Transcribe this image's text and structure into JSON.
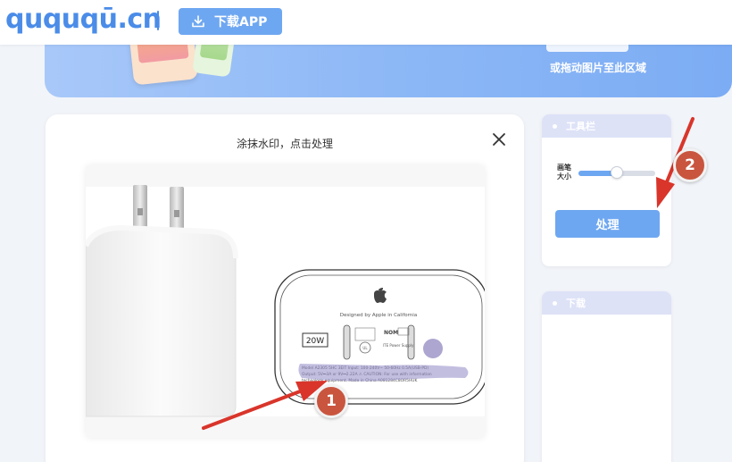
{
  "header": {
    "logo_text": "ququqū.cn",
    "app_button_label": "下载APP"
  },
  "banner": {
    "drop_hint": "或拖动图片至此区域"
  },
  "editor": {
    "title": "涂抹水印，点击处理",
    "image": {
      "label_designed": "Designed by Apple in California",
      "wattage": "20W",
      "nom_text": "NOM",
      "supply_text": "ITE Power Supply",
      "reg_line1": "Model A2305 5HC 3EIT Input: 100-240V~ 50-60Hz 0.5A(USB-PD)",
      "reg_line2": "Output: 5V⎓3A or 9V⎓2.22A ⚠ CAUTION: For use with information",
      "reg_line3": "technology equipment. Made in China A081284C8OR5HUK"
    }
  },
  "toolbox": {
    "header": "工具栏",
    "brush_label": "画笔 大小",
    "brush_size_fraction": 0.5,
    "process_label": "处理"
  },
  "download": {
    "header": "下载"
  },
  "annotations": {
    "step1": "1",
    "step2": "2"
  },
  "colors": {
    "brand_blue": "#4a8ce8",
    "button_blue": "#6ea7f1",
    "annotation_red": "#d9352b",
    "badge_red": "#c9553f"
  }
}
